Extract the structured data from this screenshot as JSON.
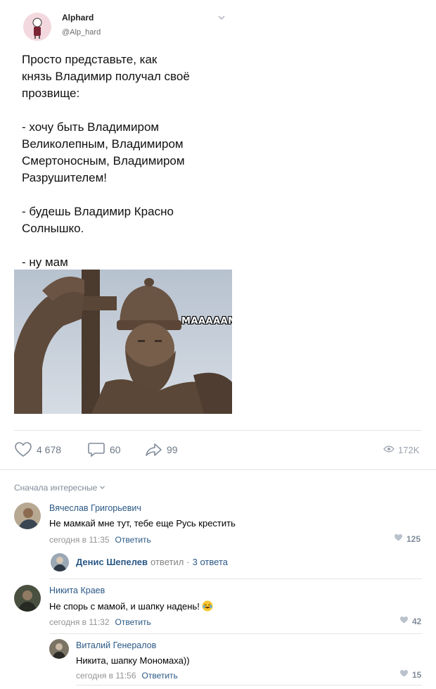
{
  "post": {
    "author_name": "Alphard",
    "author_handle": "@Alp_hard",
    "text": "Просто представьте, как\nкнязь Владимир получал своё\nпрозвище:\n\n- хочу быть Владимиром\nВеликолепным, Владимиром\nСмертоносным, Владимиром\nРазрушителем!\n\n- будешь Владимир Красно\nСолнышко.\n\n- ну мам",
    "image_caption": "МАААААМ",
    "likes": "4 678",
    "comments": "60",
    "shares": "99",
    "views": "172K"
  },
  "comments_section": {
    "sort_label": "Сначала интересные"
  },
  "comments": [
    {
      "author": "Вячеслав Григорьевич",
      "text": "Не мамкай мне тут, тебе еще Русь крестить",
      "time": "сегодня в 11:35",
      "reply_label": "Ответить",
      "likes": "125",
      "thread_author": "Денис Шепелев",
      "thread_replied": "ответил",
      "thread_count": "3 ответа"
    },
    {
      "author": "Никита Краев",
      "text": "Не спорь с мамой, и шапку надень!",
      "time": "сегодня в 11:32",
      "reply_label": "Ответить",
      "likes": "42"
    }
  ],
  "reply": {
    "author": "Виталий Генералов",
    "text": "Никита, шапку Мономаха))",
    "time": "сегодня в 11:56",
    "reply_label": "Ответить",
    "likes": "15"
  },
  "colors": {
    "link": "#2a5885",
    "meta": "#939393",
    "icon": "#818c99",
    "divider": "#e3e4e8"
  }
}
